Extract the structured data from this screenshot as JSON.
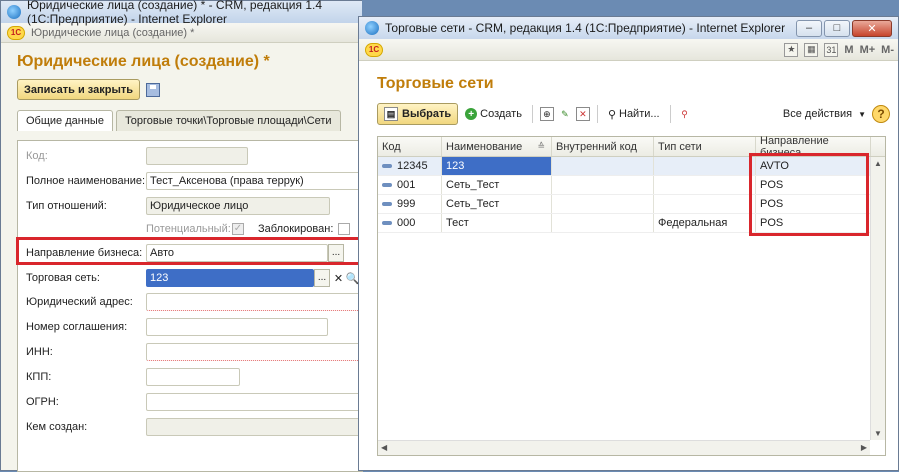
{
  "back_window": {
    "title": "Юридические лица (создание) * - CRM, редакция 1.4 (1С:Предприятие) - Internet Explorer",
    "sub_title": "Юридические лица (создание) *",
    "form_title": "Юридические лица (создание) *",
    "save_close_label": "Записать и закрыть",
    "tabs": [
      {
        "label": "Общие данные"
      },
      {
        "label": "Торговые точки\\Торговые площади\\Сети"
      }
    ],
    "fields": {
      "code_label": "Код:",
      "full_name_label": "Полное наименование:",
      "full_name_value": "Тест_Аксенова (права террук)",
      "relation_label": "Тип отношений:",
      "relation_value": "Юридическое лицо",
      "potential_label": "Потенциальный:",
      "blocked_label": "Заблокирован:",
      "business_dir_label": "Направление бизнеса:",
      "business_dir_value": "Авто",
      "trade_network_label": "Торговая сеть:",
      "trade_network_value": "123",
      "legal_address_label": "Юридический адрес:",
      "agreement_label": "Номер соглашения:",
      "inn_label": "ИНН:",
      "kpp_label": "КПП:",
      "ogrn_label": "ОГРН:",
      "created_by_label": "Кем создан:"
    },
    "dots": "...",
    "x_glyph": "✕",
    "search_glyph": "🔍",
    "check_glyph": "✓"
  },
  "front_window": {
    "title": "Торговые сети - CRM, редакция 1.4 (1С:Предприятие) - Internet Explorer",
    "list_title": "Торговые сети",
    "toolbar": {
      "m": "M",
      "m_plus": "M+",
      "m_minus": "M-",
      "cal": "31"
    },
    "choose_label": "Выбрать",
    "create_label": "Создать",
    "find_label": "Найти...",
    "all_actions_label": "Все действия",
    "help_glyph": "?",
    "columns": [
      "Код",
      "Наименование",
      "Внутренний код",
      "Тип сети",
      "Направление бизнеса"
    ],
    "rows": [
      {
        "code": "12345",
        "name": "123",
        "internal": "",
        "type": "",
        "direction": "AVTO"
      },
      {
        "code": "001",
        "name": "Сеть_Тест",
        "internal": "",
        "type": "",
        "direction": "POS"
      },
      {
        "code": "999",
        "name": "Сеть_Тест",
        "internal": "",
        "type": "",
        "direction": "POS"
      },
      {
        "code": "000",
        "name": "Тест",
        "internal": "",
        "type": "Федеральная",
        "direction": "POS"
      }
    ]
  },
  "win_buttons": {
    "minimize": "–",
    "maximize": "□",
    "close": "✕"
  },
  "logo_text": "1С",
  "colors": {
    "accent_title": "#c07d0a",
    "highlight": "#d9262c",
    "selection": "#3e6ec6"
  }
}
